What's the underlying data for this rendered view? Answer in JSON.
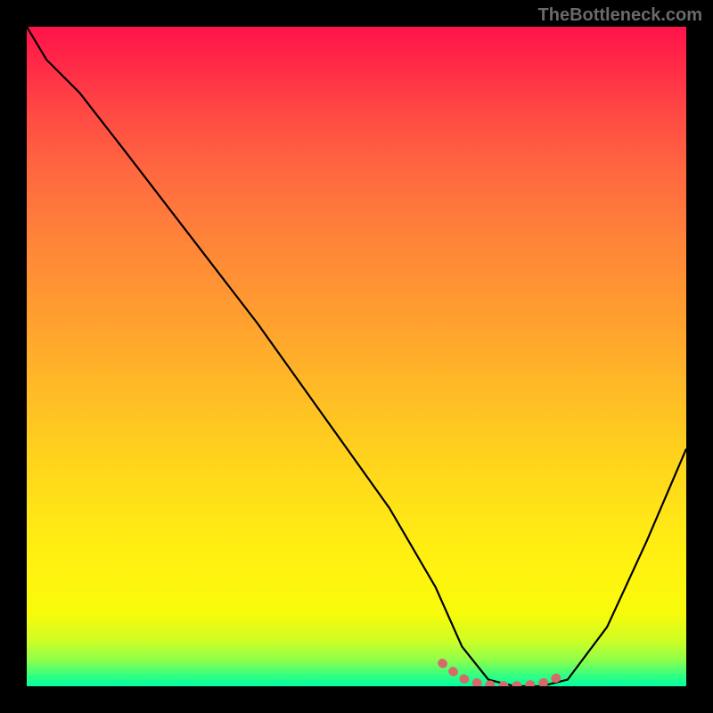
{
  "attribution": "TheBottleneck.com",
  "colors": {
    "background": "#000000",
    "curve": "#000000",
    "marker": "#d66a6a",
    "gradient_top": "#ff134a",
    "gradient_bottom": "#00ffa2"
  },
  "chart_data": {
    "type": "line",
    "title": "",
    "xlabel": "",
    "ylabel": "",
    "xlim": [
      0,
      100
    ],
    "ylim": [
      0,
      100
    ],
    "series": [
      {
        "name": "bottleneck-curve",
        "x": [
          0,
          3,
          8,
          15,
          25,
          35,
          45,
          55,
          62,
          66,
          70,
          74,
          78,
          82,
          88,
          94,
          100
        ],
        "values": [
          100,
          95,
          90,
          81,
          68,
          55,
          41,
          27,
          15,
          6,
          1,
          0,
          0,
          1,
          9,
          22,
          36
        ]
      }
    ],
    "annotations": [
      {
        "name": "flat-minimum",
        "x": [
          63,
          66,
          69,
          72,
          75,
          78,
          81
        ],
        "values": [
          3.5,
          1.2,
          0.3,
          0.1,
          0.1,
          0.4,
          1.5
        ]
      }
    ]
  }
}
